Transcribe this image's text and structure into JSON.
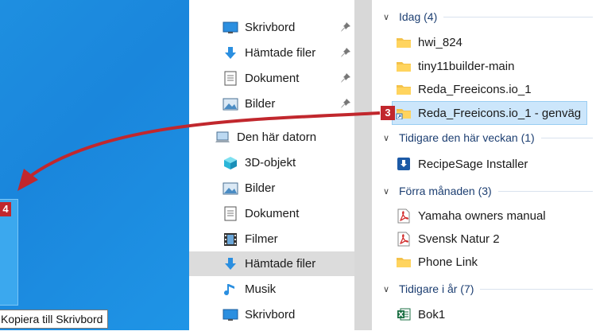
{
  "badges": {
    "step3": "3",
    "step4": "4"
  },
  "tooltip": "Kopiera till Skrivbord",
  "nav": {
    "items": [
      {
        "label": "Skrivbord",
        "icon": "desktop-icon",
        "pinned": true
      },
      {
        "label": "Hämtade filer",
        "icon": "download-icon",
        "pinned": true
      },
      {
        "label": "Dokument",
        "icon": "document-icon",
        "pinned": true
      },
      {
        "label": "Bilder",
        "icon": "pictures-icon",
        "pinned": true
      },
      {
        "label": "Den här datorn",
        "icon": "computer-icon"
      },
      {
        "label": "3D-objekt",
        "icon": "cube-icon"
      },
      {
        "label": "Bilder",
        "icon": "pictures-icon"
      },
      {
        "label": "Dokument",
        "icon": "document-icon"
      },
      {
        "label": "Filmer",
        "icon": "film-icon"
      },
      {
        "label": "Hämtade filer",
        "icon": "download-icon",
        "selected": true
      },
      {
        "label": "Musik",
        "icon": "music-icon"
      },
      {
        "label": "Skrivbord",
        "icon": "desktop-icon"
      }
    ]
  },
  "content": {
    "groups": [
      {
        "label": "Idag (4)",
        "files": [
          {
            "name": "hwi_824",
            "icon": "folder-icon"
          },
          {
            "name": "tiny11builder-main",
            "icon": "folder-icon"
          },
          {
            "name": "Reda_Freeicons.io_1",
            "icon": "folder-icon"
          },
          {
            "name": "Reda_Freeicons.io_1 - genväg",
            "icon": "folder-shortcut-icon",
            "selected": true
          }
        ]
      },
      {
        "label": "Tidigare den här veckan (1)",
        "files": [
          {
            "name": "RecipeSage Installer",
            "icon": "installer-icon"
          }
        ]
      },
      {
        "label": "Förra månaden (3)",
        "files": [
          {
            "name": "Yamaha owners manual",
            "icon": "pdf-icon"
          },
          {
            "name": "Svensk Natur 2",
            "icon": "pdf-icon"
          },
          {
            "name": "Phone Link",
            "icon": "folder-icon"
          }
        ]
      },
      {
        "label": "Tidigare i år (7)",
        "files": [
          {
            "name": "Bok1",
            "icon": "excel-icon"
          }
        ]
      }
    ]
  },
  "colors": {
    "accent": "#c1272d",
    "selection": "#cce6fb",
    "desktop": "#1a86dc",
    "header_text": "#1d3f72"
  }
}
